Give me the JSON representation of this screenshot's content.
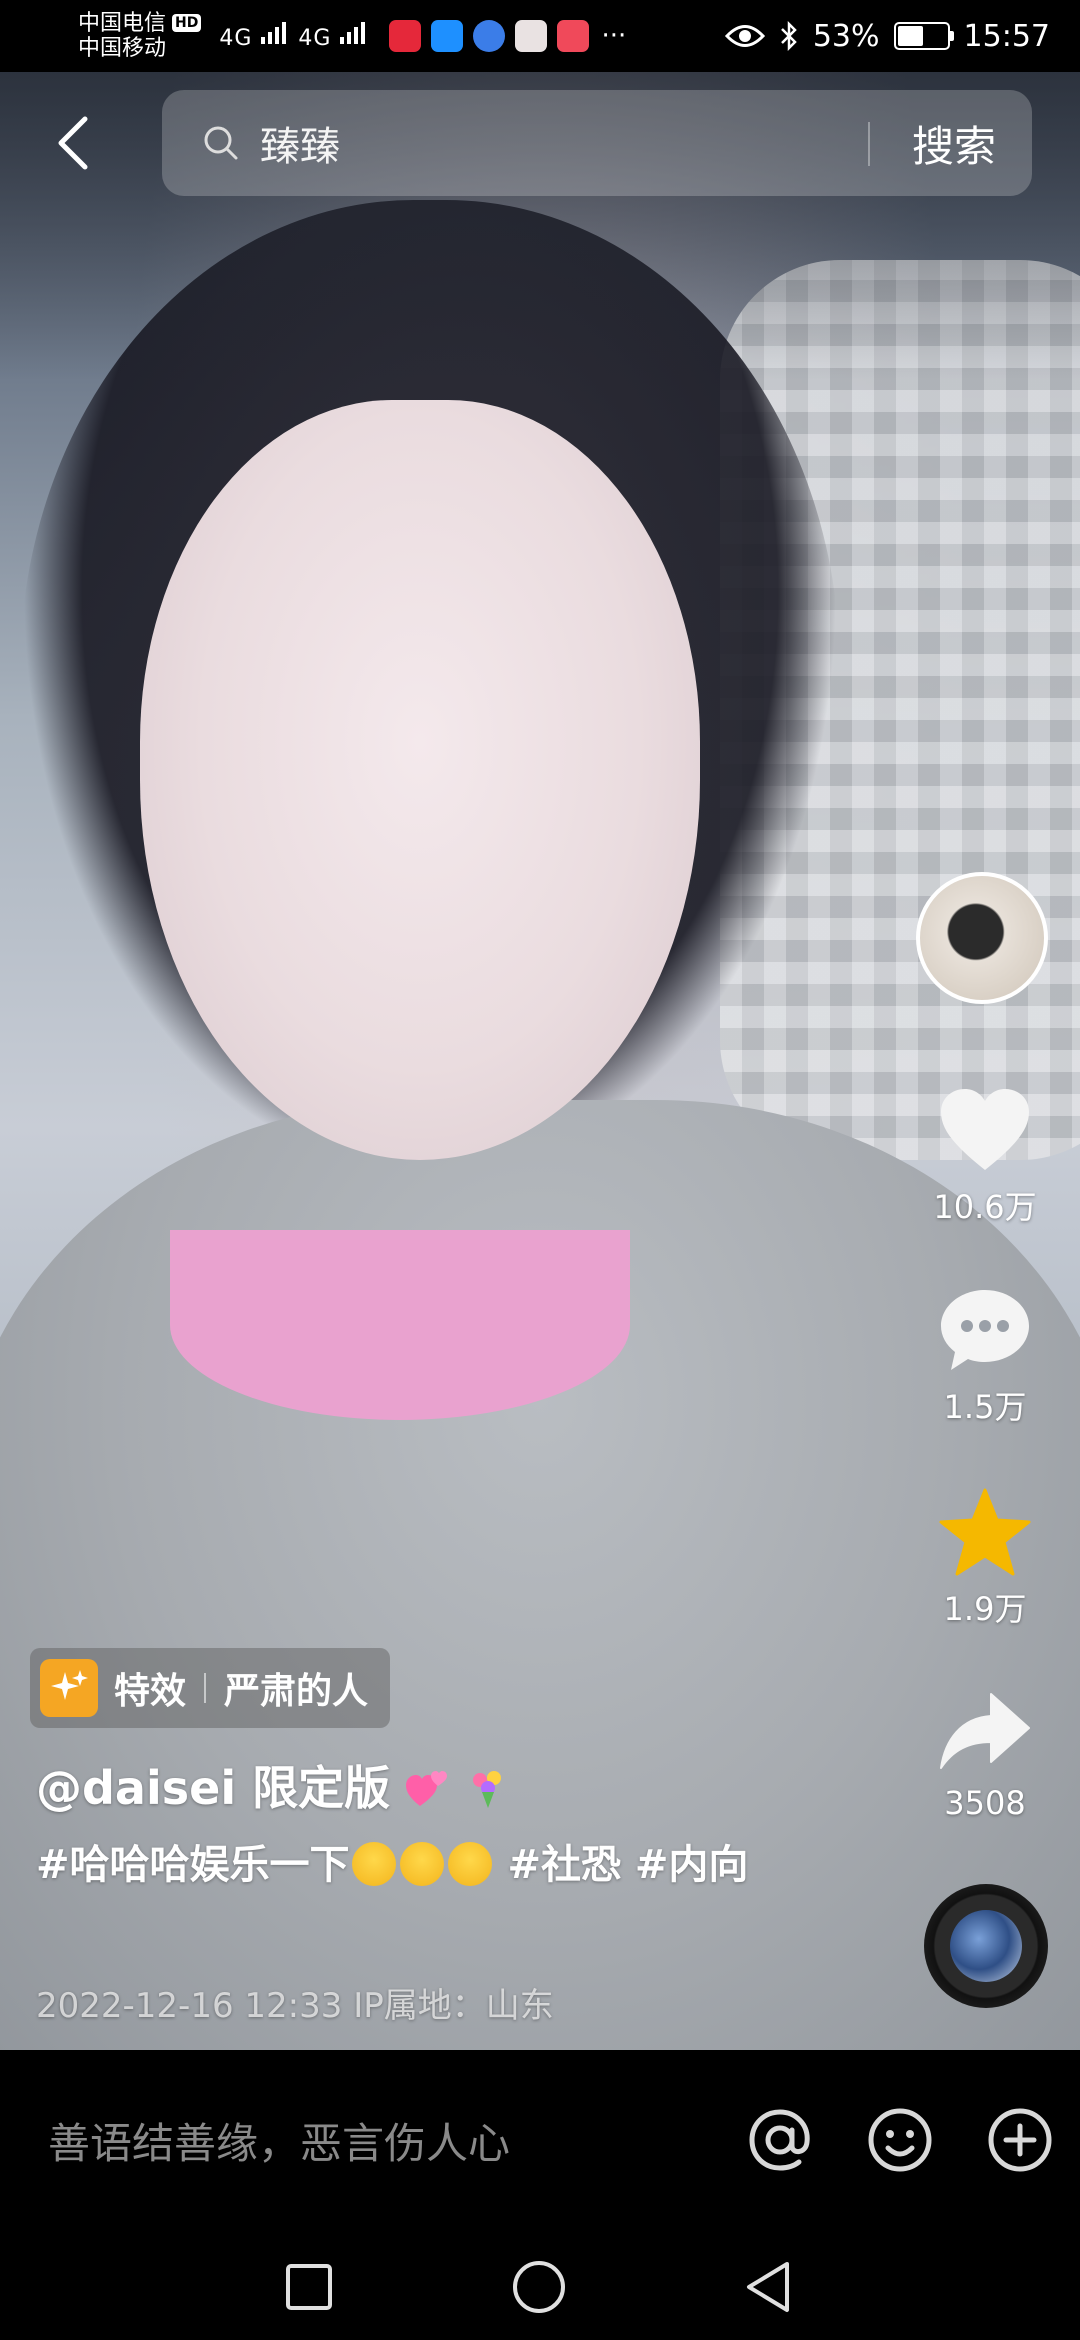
{
  "status_bar": {
    "carrier_1": "中国电信",
    "hd_badge": "HD",
    "carrier_2": "中国移动",
    "signal_1": "4G",
    "signal_2": "4G",
    "more": "···",
    "battery_percent": "53%",
    "battery_level": 0.53,
    "time": "15:57"
  },
  "search": {
    "query": "臻臻",
    "button_label": "搜索"
  },
  "actions": {
    "like_count": "10.6万",
    "comment_count": "1.5万",
    "favorite_count": "1.9万",
    "share_count": "3508"
  },
  "caption": {
    "effect_label": "特效",
    "effect_name": "严肃的人",
    "author_line": "@daisei 限定版",
    "text_part_1": "#哈哈哈娱乐一下",
    "text_part_2": " #社恐 #内向",
    "meta": "2022-12-16 12:33  IP属地：山东"
  },
  "comment_bar": {
    "placeholder": "善语结善缘，恶言伤人心"
  },
  "colors": {
    "accent_star": "#f5b800",
    "effect_icon": "#f5a623"
  },
  "icons": [
    "back-icon",
    "search-icon",
    "heart-icon",
    "comment-icon",
    "star-icon",
    "share-icon",
    "at-icon",
    "emoji-icon",
    "add-icon",
    "nav-recents-icon",
    "nav-home-icon",
    "nav-back-icon"
  ]
}
